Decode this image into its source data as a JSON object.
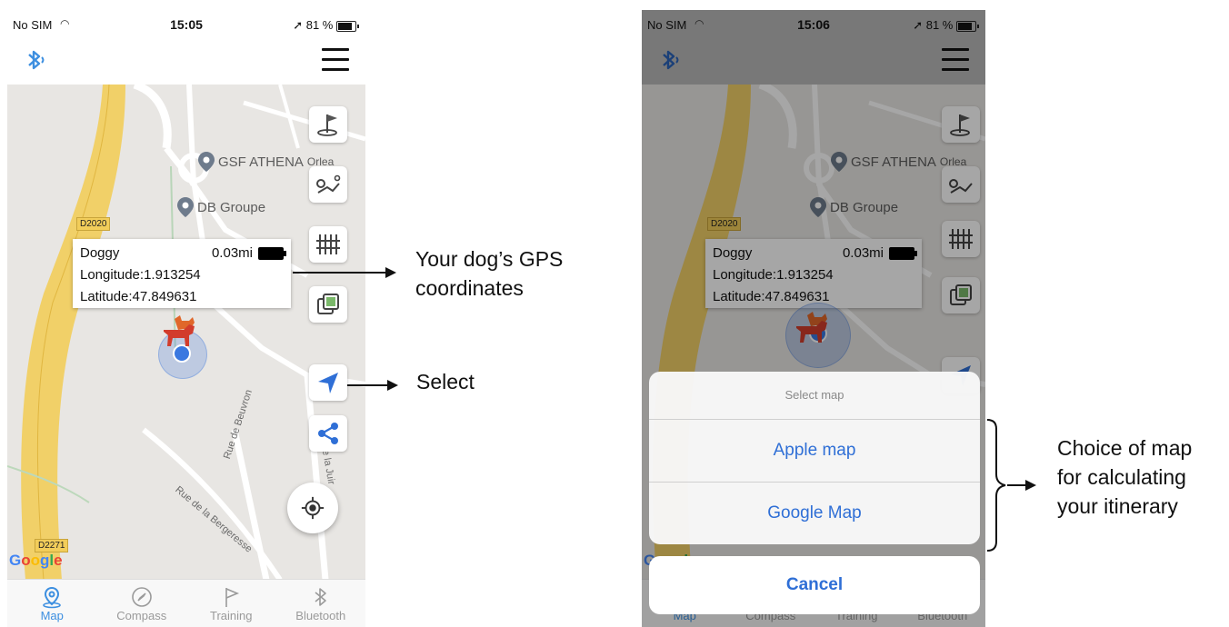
{
  "screens": [
    {
      "status": {
        "carrier": "No SIM",
        "time": "15:05",
        "battery": "81 %"
      },
      "pois": [
        "GSF ATHENA",
        "Orlea",
        "DB Groupe"
      ],
      "road_labels": [
        "D2020",
        "D2271"
      ],
      "street_labels": [
        "Rue de Beuvron",
        "Rue de la Bergeresse",
        "ue de la Juir"
      ],
      "callout": {
        "name": "Doggy",
        "distance": "0.03mi",
        "longitude": "Longitude:1.913254",
        "latitude": "Latitude:47.849631"
      },
      "tabs": [
        "Map",
        "Compass",
        "Training",
        "Bluetooth"
      ]
    },
    {
      "status": {
        "carrier": "No SIM",
        "time": "15:06",
        "battery": "81 %"
      },
      "pois": [
        "GSF ATHENA",
        "Orlea",
        "DB Groupe"
      ],
      "road_labels": [
        "D2020"
      ],
      "callout": {
        "name": "Doggy",
        "distance": "0.03mi",
        "longitude": "Longitude:1.913254",
        "latitude": "Latitude:47.849631"
      },
      "tabs": [
        "Map",
        "Compass",
        "Training",
        "Bluetooth"
      ],
      "sheet": {
        "title": "Select map",
        "options": [
          "Apple map",
          "Google Map"
        ],
        "cancel": "Cancel"
      }
    }
  ],
  "annotations": {
    "gps": "Your dog’s GPS coordinates",
    "gps_line1": "Your dog’s GPS",
    "gps_line2": "coordinates",
    "select": "Select",
    "choice_line1": "Choice of map",
    "choice_line2": "for calculating",
    "choice_line3": "your itinerary"
  },
  "google_logo": "Google",
  "colors": {
    "accent": "#3d8fe0",
    "road_major": "#f2cd5a",
    "map_bg": "#e8e6e3",
    "sheet_text": "#2f6fd6"
  },
  "icons": [
    "bluetooth-icon",
    "menu-icon",
    "flag-icon",
    "route-icon",
    "fence-icon",
    "layers-icon",
    "navigate-arrow-icon",
    "share-icon",
    "locate-icon"
  ]
}
